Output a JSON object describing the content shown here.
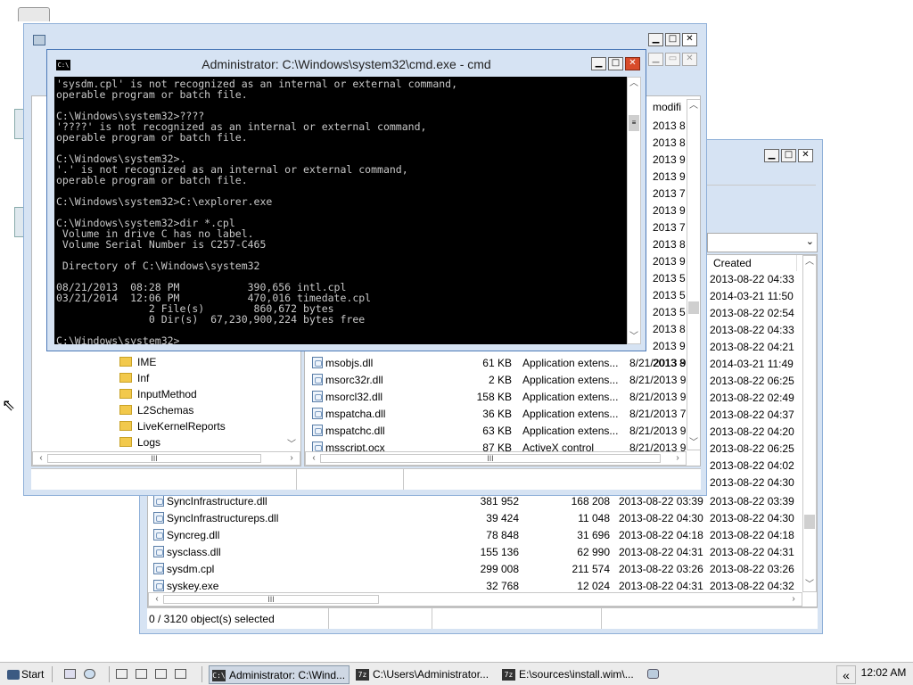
{
  "cmd": {
    "title": "Administrator: C:\\Windows\\system32\\cmd.exe - cmd",
    "icon_label": "C:\\",
    "lines": [
      "'sysdm.cpl' is not recognized as an internal or external command,",
      "operable program or batch file.",
      "",
      "C:\\Windows\\system32>????",
      "'????' is not recognized as an internal or external command,",
      "operable program or batch file.",
      "",
      "C:\\Windows\\system32>.",
      "'.' is not recognized as an internal or external command,",
      "operable program or batch file.",
      "",
      "C:\\Windows\\system32>C:\\explorer.exe",
      "",
      "C:\\Windows\\system32>dir *.cpl",
      " Volume in drive C has no label.",
      " Volume Serial Number is C257-C465",
      "",
      " Directory of C:\\Windows\\system32",
      "",
      "08/21/2013  08:28 PM           390,656 intl.cpl",
      "03/21/2014  12:06 PM           470,016 timedate.cpl",
      "               2 File(s)        860,672 bytes",
      "               0 Dir(s)  67,230,900,224 bytes free",
      "",
      "C:\\Windows\\system32>"
    ]
  },
  "explorer1": {
    "column_modified": "modifi",
    "modified_col": [
      "2013 8",
      "2013 8",
      "2013 9",
      "2013 9",
      "2013 7",
      "2013 9",
      "2013 7",
      "2013 8",
      "2013 9",
      "2013 5",
      "2013 5",
      "2013 5",
      "2013 8",
      "2013 9",
      "2013 8"
    ],
    "tree_items": [
      "IME",
      "Inf",
      "InputMethod",
      "L2Schemas",
      "LiveKernelReports",
      "Logs"
    ],
    "files": [
      {
        "name": "msobjs.dll",
        "size": "61 KB",
        "type": "Application extens...",
        "date": "8/21/2013 9"
      },
      {
        "name": "msorc32r.dll",
        "size": "2 KB",
        "type": "Application extens...",
        "date": "8/21/2013 9"
      },
      {
        "name": "msorcl32.dll",
        "size": "158 KB",
        "type": "Application extens...",
        "date": "8/21/2013 9"
      },
      {
        "name": "mspatcha.dll",
        "size": "36 KB",
        "type": "Application extens...",
        "date": "8/21/2013 7"
      },
      {
        "name": "mspatchc.dll",
        "size": "63 KB",
        "type": "Application extens...",
        "date": "8/21/2013 9"
      },
      {
        "name": "msscript.ocx",
        "size": "87 KB",
        "type": "ActiveX control",
        "date": "8/21/2013 9"
      }
    ],
    "scroll_thumb": "III"
  },
  "explorer2": {
    "column_created": "Created",
    "created_col": [
      "2013-08-22 04:33",
      "2014-03-21 11:50",
      "2013-08-22 02:54",
      "2013-08-22 04:33",
      "2013-08-22 04:21",
      "2014-03-21 11:49",
      "2013-08-22 06:25",
      "2013-08-22 02:49",
      "2013-08-22 04:37",
      "2013-08-22 04:20",
      "2013-08-22 06:25",
      "2013-08-22 04:02",
      "2013-08-22 04:30"
    ],
    "files": [
      {
        "name": "SyncInfrastructure.dll",
        "size": "381 952",
        "packed": "168 208",
        "modified": "2013-08-22 03:39",
        "created": "2013-08-22 03:39"
      },
      {
        "name": "SyncInfrastructureps.dll",
        "size": "39 424",
        "packed": "11 048",
        "modified": "2013-08-22 04:30",
        "created": "2013-08-22 04:30"
      },
      {
        "name": "Syncreg.dll",
        "size": "78 848",
        "packed": "31 696",
        "modified": "2013-08-22 04:18",
        "created": "2013-08-22 04:18"
      },
      {
        "name": "sysclass.dll",
        "size": "155 136",
        "packed": "62 990",
        "modified": "2013-08-22 04:31",
        "created": "2013-08-22 04:31"
      },
      {
        "name": "sysdm.cpl",
        "size": "299 008",
        "packed": "211 574",
        "modified": "2013-08-22 03:26",
        "created": "2013-08-22 03:26"
      },
      {
        "name": "syskey.exe",
        "size": "32 768",
        "packed": "12 024",
        "modified": "2013-08-22 04:31",
        "created": "2013-08-22 04:32"
      }
    ],
    "status": "0 / 3120 object(s) selected",
    "scroll_thumb": "III"
  },
  "taskbar": {
    "start_label": "Start",
    "items": [
      {
        "label": "Administrator: C:\\Wind...",
        "icon": "C:\\"
      },
      {
        "label": "C:\\Users\\Administrator...",
        "icon": "7z"
      },
      {
        "label": "E:\\sources\\install.wim\\...",
        "icon": "7z"
      }
    ],
    "clock": "12:02 AM",
    "chevron": "«"
  }
}
